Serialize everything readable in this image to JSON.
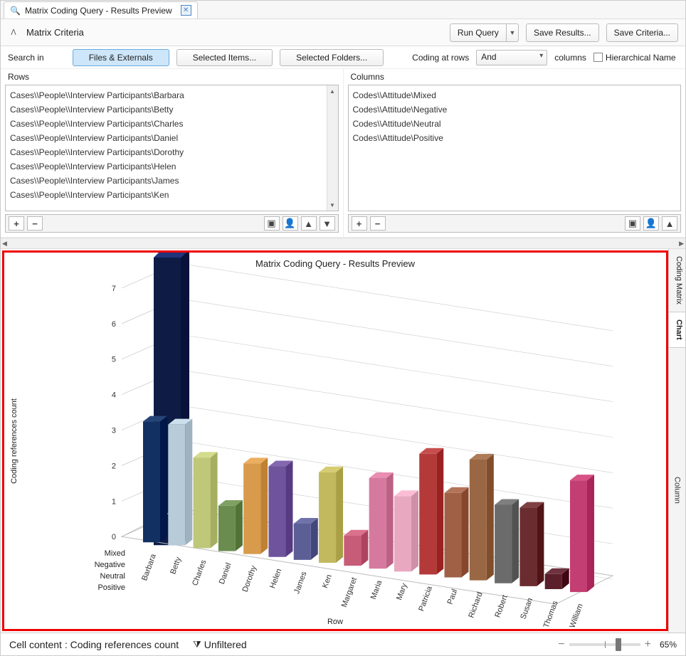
{
  "tab": {
    "title": "Matrix Coding Query - Results Preview"
  },
  "criteria": {
    "title": "Matrix Criteria",
    "run": "Run Query",
    "save_results": "Save Results...",
    "save_criteria": "Save Criteria..."
  },
  "search": {
    "label": "Search in",
    "seg_files": "Files & Externals",
    "seg_items": "Selected Items...",
    "seg_folders": "Selected Folders...",
    "coding_rows": "Coding at rows",
    "and": "And",
    "columns": "columns",
    "hier": "Hierarchical Name"
  },
  "rows": {
    "title": "Rows",
    "items": [
      "Cases\\\\People\\\\Interview Participants\\Barbara",
      "Cases\\\\People\\\\Interview Participants\\Betty",
      "Cases\\\\People\\\\Interview Participants\\Charles",
      "Cases\\\\People\\\\Interview Participants\\Daniel",
      "Cases\\\\People\\\\Interview Participants\\Dorothy",
      "Cases\\\\People\\\\Interview Participants\\Helen",
      "Cases\\\\People\\\\Interview Participants\\James",
      "Cases\\\\People\\\\Interview Participants\\Ken"
    ]
  },
  "cols": {
    "title": "Columns",
    "items": [
      "Codes\\\\Attitude\\Mixed",
      "Codes\\\\Attitude\\Negative",
      "Codes\\\\Attitude\\Neutral",
      "Codes\\\\Attitude\\Positive"
    ]
  },
  "chart_data": {
    "type": "bar",
    "title": "Matrix Coding Query - Results Preview",
    "ylabel": "Coding references count",
    "xlabel": "Row",
    "zlabel": "Column",
    "ylim": [
      0,
      7
    ],
    "yticks": [
      0,
      1,
      2,
      3,
      4,
      5,
      6,
      7
    ],
    "z_categories": [
      "Mixed",
      "Negative",
      "Neutral",
      "Positive"
    ],
    "categories": [
      "Barbara",
      "Betty",
      "Charles",
      "Daniel",
      "Dorothy",
      "Helen",
      "James",
      "Ken",
      "Margaret",
      "Maria",
      "Mary",
      "Patricia",
      "Paul",
      "Richard",
      "Robert",
      "Susan",
      "Thomas",
      "William"
    ],
    "series": [
      {
        "name": "Mixed",
        "color": "#0f1e52",
        "values": [
          4.0,
          1.0,
          0.0,
          0.0,
          0.0,
          0.0,
          0.0,
          0.0,
          0.0,
          0.0,
          0.0,
          0.0,
          0.0,
          0.0,
          0.0,
          0.0,
          0.0,
          0.0
        ]
      },
      {
        "name": "Negative",
        "color": "#0f1e52",
        "values": [
          7.5,
          0.0,
          0.0,
          0.0,
          0.0,
          0.0,
          0.0,
          0.0,
          0.0,
          0.0,
          0.0,
          0.0,
          0.0,
          0.0,
          0.0,
          0.0,
          0.0,
          0.0
        ]
      },
      {
        "name": "Neutral",
        "color": "#0f1e52",
        "values": [
          0.0,
          0.0,
          0.0,
          0.0,
          0.0,
          0.0,
          0.0,
          0.0,
          0.0,
          0.0,
          0.0,
          0.0,
          0.0,
          0.0,
          0.0,
          0.0,
          0.0,
          0.0
        ]
      },
      {
        "name": "Positive",
        "color": "#0f1e52",
        "values": [
          0.0,
          0.0,
          0.0,
          0.0,
          0.0,
          0.0,
          0.0,
          0.0,
          0.0,
          0.0,
          0.0,
          0.0,
          0.0,
          0.0,
          0.0,
          0.0,
          0.0,
          0.0
        ]
      }
    ],
    "front_bars": [
      {
        "name": "Barbara",
        "color": "#133063",
        "value": 4.0
      },
      {
        "name": "Betty",
        "color": "#b8cbd8",
        "value": 4.0
      },
      {
        "name": "Charles",
        "color": "#bfc779",
        "value": 3.0
      },
      {
        "name": "Daniel",
        "color": "#6b8c4f",
        "value": 1.5
      },
      {
        "name": "Dorothy",
        "color": "#d89a4b",
        "value": 3.0
      },
      {
        "name": "Helen",
        "color": "#6f549c",
        "value": 3.0
      },
      {
        "name": "James",
        "color": "#5c5f96",
        "value": 1.2
      },
      {
        "name": "Ken",
        "color": "#c2b95e",
        "value": 3.0
      },
      {
        "name": "Margaret",
        "color": "#c75c78",
        "value": 1.0
      },
      {
        "name": "Maria",
        "color": "#d57a9e",
        "value": 3.0
      },
      {
        "name": "Mary",
        "color": "#e8a9c0",
        "value": 2.5
      },
      {
        "name": "Patricia",
        "color": "#b43a3a",
        "value": 4.0
      },
      {
        "name": "Paul",
        "color": "#a06046",
        "value": 2.8
      },
      {
        "name": "Richard",
        "color": "#9a6744",
        "value": 4.0
      },
      {
        "name": "Robert",
        "color": "#6b6b6b",
        "value": 2.6
      },
      {
        "name": "Susan",
        "color": "#6b2c2f",
        "value": 2.6
      },
      {
        "name": "Thomas",
        "color": "#5a1f2a",
        "value": 0.5
      },
      {
        "name": "William",
        "color": "#c33e72",
        "value": 3.7
      }
    ]
  },
  "side": {
    "matrix": "Coding Matrix",
    "chart": "Chart",
    "column": "Column"
  },
  "status": {
    "cell": "Cell content : Coding references count",
    "filter": "Unfiltered",
    "zoom": "65%"
  }
}
